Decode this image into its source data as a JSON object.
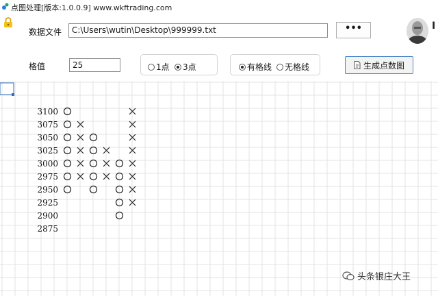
{
  "window": {
    "title": "点图处理[版本:1.0.0.9] www.wkftrading.com"
  },
  "file_row": {
    "label": "数据文件",
    "path_value": "C:\\Users\\wutin\\Desktop\\999999.txt",
    "browse_label": "•••"
  },
  "settings": {
    "grid_value_label": "格值",
    "grid_value": "25",
    "reversal_options": [
      {
        "label": "1点",
        "checked": false
      },
      {
        "label": "3点",
        "checked": true
      }
    ],
    "grid_line_options": [
      {
        "label": "有格线",
        "checked": true
      },
      {
        "label": "无格线",
        "checked": false
      }
    ],
    "generate_button_label": "生成点数图"
  },
  "header_right": {
    "cut_letter": "I"
  },
  "pf_chart": {
    "price_labels": [
      "3100",
      "3075",
      "3050",
      "3025",
      "3000",
      "2975",
      "2950",
      "2925",
      "2900",
      "2875"
    ],
    "columns": [
      {
        "type": "O",
        "cells": [
          "3100",
          "3075",
          "3050",
          "3025",
          "3000",
          "2975",
          "2950"
        ]
      },
      {
        "type": "X",
        "cells": [
          "3075",
          "3050",
          "3025",
          "3000",
          "2975"
        ]
      },
      {
        "type": "O",
        "cells": [
          "3050",
          "3025",
          "3000",
          "2975",
          "2950"
        ]
      },
      {
        "type": "X",
        "cells": [
          "3025",
          "3000",
          "2975"
        ]
      },
      {
        "type": "O",
        "cells": [
          "3000",
          "2975",
          "2950",
          "2925",
          "2900"
        ]
      },
      {
        "type": "X",
        "cells": [
          "3100",
          "3075",
          "3050",
          "3025",
          "3000",
          "2975",
          "2950",
          "2925"
        ]
      }
    ],
    "grid_lines": true
  },
  "watermark": {
    "text": "头条银庄大王"
  }
}
